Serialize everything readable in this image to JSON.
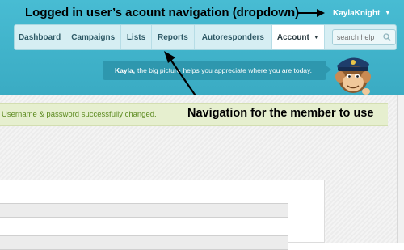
{
  "annotations": {
    "top": "Logged in user’s acount navigation (dropdown)",
    "middle": "Navigation for the member to use"
  },
  "user_menu": {
    "username": "KaylaKnight",
    "caret": "▼"
  },
  "nav": {
    "items": [
      {
        "label": "Dashboard"
      },
      {
        "label": "Campaigns"
      },
      {
        "label": "Lists"
      },
      {
        "label": "Reports"
      },
      {
        "label": "Autoresponders"
      },
      {
        "label": "Account",
        "active": true,
        "has_dropdown": true
      }
    ],
    "dropdown_caret": "▼",
    "search": {
      "placeholder": "search help",
      "icon": "search-icon"
    }
  },
  "tip": {
    "name": "Kayla,",
    "link_text": "the big picture",
    "rest": "helps you appreciate where you are today."
  },
  "message": {
    "success": "Username & password successfully changed."
  },
  "colors": {
    "header": "#3fb1c8",
    "tip_bg": "#2e97ae",
    "success_bg": "#e6efcf",
    "success_text": "#5c8a1f"
  }
}
